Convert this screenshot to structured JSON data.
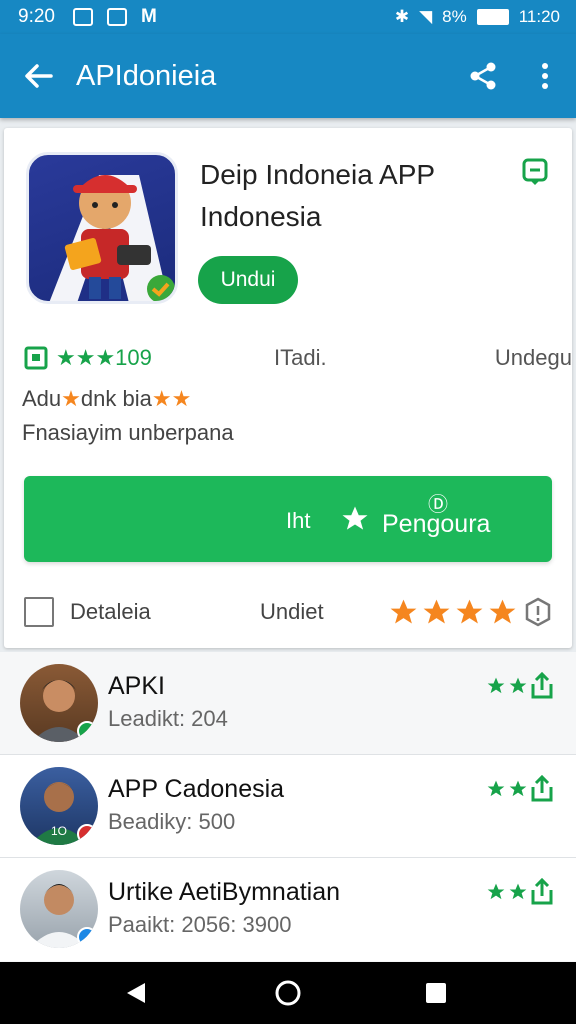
{
  "status": {
    "time": "9:20",
    "battery_text": "8%",
    "clock": "11:20"
  },
  "appbar": {
    "title": "APIdonieia"
  },
  "app": {
    "name_line1": "Deip Indoneia APP",
    "name_line2": "Indonesia",
    "install_label": "Undui"
  },
  "meta": {
    "rating_text": "★★★109",
    "col2": "ITadi.",
    "col3": "Undegu"
  },
  "desc": {
    "line1_a": "Adu",
    "line1_b": "dnk bia",
    "line2": "Fnasiayim unberpana"
  },
  "big_button": {
    "left_text": "Iht",
    "label": "Pengoura"
  },
  "details": {
    "label": "Detaleia",
    "col2": "Undiet",
    "rating": 4
  },
  "reviews": [
    {
      "name": "APKI",
      "sub": "Leadikt: 204",
      "stars": 2
    },
    {
      "name": "APP Cadonesia",
      "sub": "Beadiky: 500",
      "stars": 2
    },
    {
      "name": "Urtike AetiBymnatian",
      "sub": "Paaikt: 2056: 3900",
      "stars": 2
    }
  ],
  "colors": {
    "primary": "#1788c3",
    "green": "#17a34a",
    "orange": "#f5861f"
  }
}
